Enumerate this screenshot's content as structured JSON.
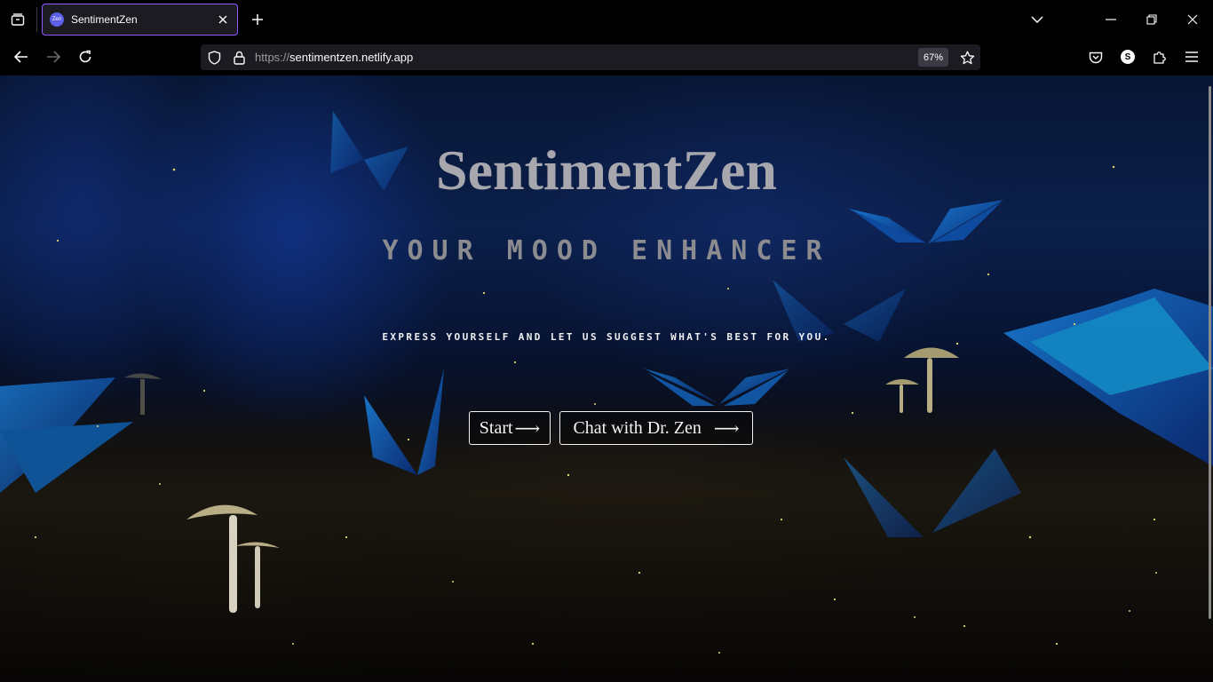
{
  "browser": {
    "tab": {
      "title": "SentimentZen",
      "favicon_text": "Zen"
    },
    "url": {
      "protocol": "https://",
      "host": "sentimentzen.netlify.app"
    },
    "zoom": "67%",
    "profile_initial": "S",
    "accent_color": "#9059ff"
  },
  "page": {
    "title": "SentimentZen",
    "subtitle": "YOUR MOOD ENHANCER",
    "tagline": "EXPRESS YOURSELF AND LET US SUGGEST WHAT'S BEST FOR YOU.",
    "buttons": {
      "start_label": "Start",
      "start_arrow": "⟶",
      "chat_label": "Chat with Dr. Zen",
      "chat_arrow": "⟶"
    },
    "colors": {
      "title": "#a7a7ad",
      "subtitle": "#8b8b90",
      "tagline": "#f0f0f0",
      "background": "#0b1f4a"
    }
  }
}
